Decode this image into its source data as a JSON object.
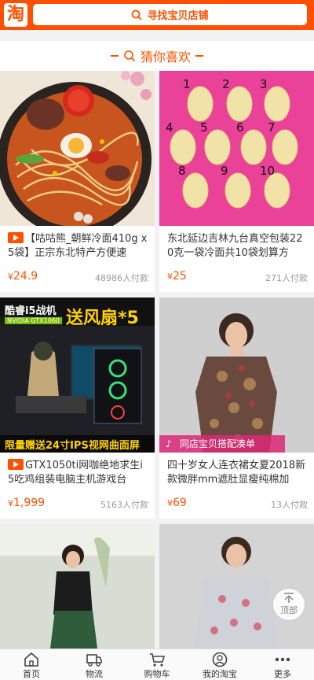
{
  "header": {
    "logo_char": "淘",
    "search_label": "寻找宝贝店铺"
  },
  "section": {
    "title": "猜你喜欢"
  },
  "products": [
    {
      "title": "【咕咕熊_朝鲜冷面410g x5袋】正宗东北特产方便速",
      "has_video": true,
      "currency": "¥",
      "price": "24.9",
      "sold": "48986人付款"
    },
    {
      "title": "东北延边吉林九台真空包装220克一袋冷面共10袋划算方",
      "has_video": false,
      "currency": "¥",
      "price": "25",
      "sold": "271人付款",
      "packet_numbers": [
        "1",
        "2",
        "3",
        "4",
        "5",
        "6",
        "7",
        "8",
        "9",
        "10"
      ]
    },
    {
      "title": "GTX1050ti网咖绝地求生i5吃鸡组装电脑主机游戏台",
      "has_video": true,
      "currency": "¥",
      "price": "1,999",
      "sold": "5163人付款",
      "banner_top": "酷睿i5战机",
      "banner_top_sub": "NVIDIA GTX1060",
      "banner_top_right": "送风扇*5",
      "banner_bottom": "限量赠送24寸IPS视网曲面屏"
    },
    {
      "title": "四十岁女人连衣裙女夏2018新款微胖mm遮肚显瘦纯棉加",
      "has_video": false,
      "currency": "¥",
      "price": "69",
      "sold": "13人付款",
      "badge": "同店宝贝搭配凑单"
    }
  ],
  "back_to_top": {
    "label": "顶部"
  },
  "tabbar": [
    {
      "label": "首页",
      "icon": "home-icon"
    },
    {
      "label": "物流",
      "icon": "truck-icon"
    },
    {
      "label": "购物车",
      "icon": "cart-icon"
    },
    {
      "label": "我的淘宝",
      "icon": "user-icon"
    },
    {
      "label": "更多",
      "icon": "more-icon"
    }
  ],
  "colors": {
    "brand": "#ff5000",
    "badge_pink": "#dc2878"
  }
}
